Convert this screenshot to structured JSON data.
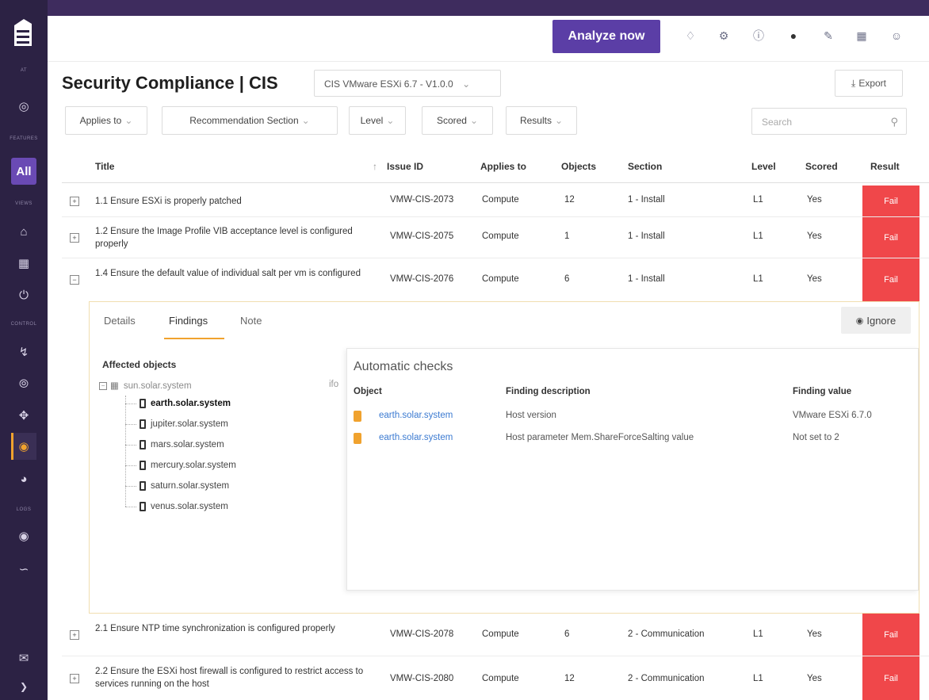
{
  "sidebar": {
    "captions": [
      "AT",
      "FEATURES",
      "VIEWS",
      "CONTROL",
      "LOGS"
    ],
    "all_label": "All",
    "icons": [
      "globe-icon",
      "home-icon",
      "calendar-icon",
      "power-icon",
      "lightning-icon",
      "compass-icon",
      "move-icon",
      "shield-icon",
      "speed-icon",
      "eye-icon",
      "trend-icon",
      "mail-icon",
      "chevron-right-icon"
    ]
  },
  "topbar": {
    "analyze_label": "Analyze now",
    "icons": [
      "bell-icon",
      "settings-icon",
      "help-icon",
      "chat-icon",
      "tools-icon",
      "grid-icon",
      "user-icon"
    ]
  },
  "header": {
    "title": "Security Compliance | CIS",
    "benchmark": "CIS VMware ESXi 6.7 - V1.0.0",
    "export_label": "Export"
  },
  "filters": {
    "applies_to": "Applies to",
    "recommendation_section": "Recommendation Section",
    "level": "Level",
    "scored": "Scored",
    "results": "Results",
    "search_placeholder": "Search"
  },
  "table": {
    "headers": {
      "title": "Title",
      "issue_id": "Issue ID",
      "applies_to": "Applies to",
      "objects": "Objects",
      "section": "Section",
      "level": "Level",
      "scored": "Scored",
      "result": "Result"
    },
    "rows": [
      {
        "title": "1.1 Ensure ESXi is properly patched",
        "issue_id": "VMW-CIS-2073",
        "applies_to": "Compute",
        "objects": "12",
        "section": "1 - Install",
        "level": "L1",
        "scored": "Yes",
        "result": "Fail"
      },
      {
        "title": "1.2 Ensure the Image Profile VIB acceptance level is configured properly",
        "issue_id": "VMW-CIS-2075",
        "applies_to": "Compute",
        "objects": "1",
        "section": "1 - Install",
        "level": "L1",
        "scored": "Yes",
        "result": "Fail"
      },
      {
        "title": "1.4 Ensure the default value of individual salt per vm is configured",
        "issue_id": "VMW-CIS-2076",
        "applies_to": "Compute",
        "objects": "6",
        "section": "1 - Install",
        "level": "L1",
        "scored": "Yes",
        "result": "Fail"
      },
      {
        "title": "2.1 Ensure NTP time synchronization is configured properly",
        "issue_id": "VMW-CIS-2078",
        "applies_to": "Compute",
        "objects": "6",
        "section": "2 - Communication",
        "level": "L1",
        "scored": "Yes",
        "result": "Fail"
      },
      {
        "title": "2.2 Ensure the ESXi host firewall is configured to restrict access to services running on the host",
        "issue_id": "VMW-CIS-2080",
        "applies_to": "Compute",
        "objects": "12",
        "section": "2 - Communication",
        "level": "L1",
        "scored": "Yes",
        "result": "Fail"
      }
    ]
  },
  "details": {
    "tabs": [
      "Details",
      "Findings",
      "Note"
    ],
    "ignore_label": "Ignore",
    "affected_title": "Affected objects",
    "tree_root": "sun.solar.system",
    "tree_root_tag": "ifo",
    "tree_items": [
      "earth.solar.system",
      "jupiter.solar.system",
      "mars.solar.system",
      "mercury.solar.system",
      "saturn.solar.system",
      "venus.solar.system"
    ],
    "checks_title": "Automatic checks",
    "checks_headers": {
      "object": "Object",
      "description": "Finding description",
      "value": "Finding value"
    },
    "checks": [
      {
        "object": "earth.solar.system",
        "description": "Host version",
        "value": "VMware ESXi 6.7.0"
      },
      {
        "object": "earth.solar.system",
        "description": "Host parameter Mem.ShareForceSalting value",
        "value": "Not set to 2"
      }
    ]
  }
}
